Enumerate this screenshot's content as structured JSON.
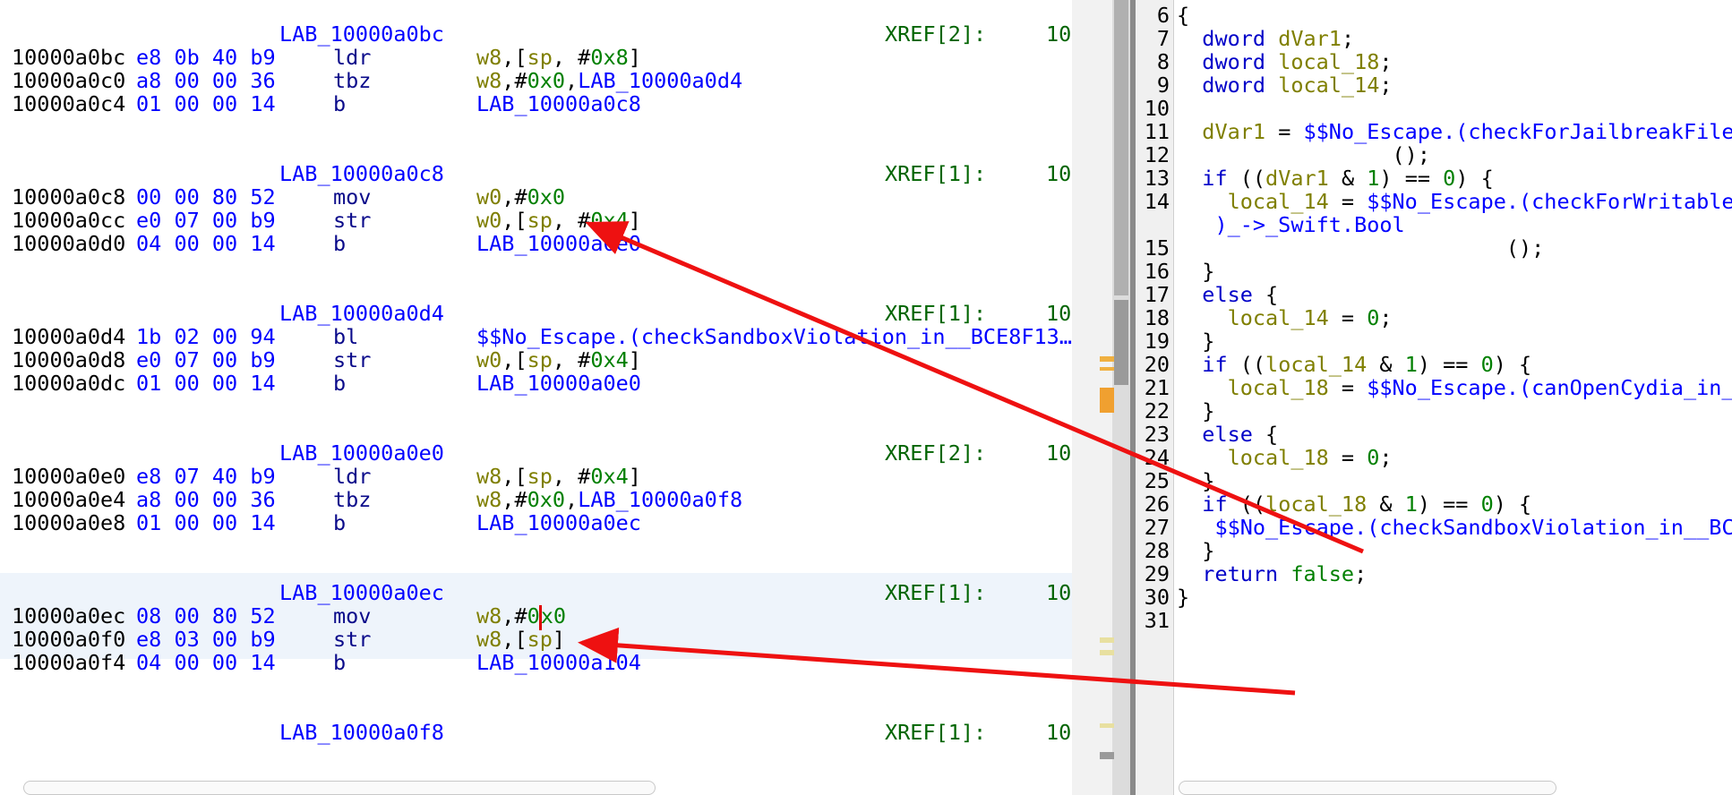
{
  "listing": {
    "blocks": [
      {
        "label": "LAB_10000a0bc",
        "xref": "XREF[2]:",
        "xref_val": "10",
        "rows": [
          {
            "addr": "10000a0bc",
            "bytes": "e8 0b 40 b9",
            "mnem": "ldr",
            "ops": [
              [
                "reg",
                "w8"
              ],
              [
                "blk",
                ",["
              ],
              [
                "reg",
                "sp"
              ],
              [
                "blk",
                ", #"
              ],
              [
                "num",
                "0x8"
              ],
              [
                "blk",
                "]"
              ]
            ]
          },
          {
            "addr": "10000a0c0",
            "bytes": "a8 00 00 36",
            "mnem": "tbz",
            "ops": [
              [
                "reg",
                "w8"
              ],
              [
                "blk",
                ",#"
              ],
              [
                "num",
                "0x0"
              ],
              [
                "blk",
                ","
              ],
              [
                "lnk",
                "LAB_10000a0d4"
              ]
            ]
          },
          {
            "addr": "10000a0c4",
            "bytes": "01 00 00 14",
            "mnem": "b",
            "ops": [
              [
                "lnk",
                "LAB_10000a0c8"
              ]
            ]
          }
        ]
      },
      {
        "label": "LAB_10000a0c8",
        "xref": "XREF[1]:",
        "xref_val": "10",
        "rows": [
          {
            "addr": "10000a0c8",
            "bytes": "00 00 80 52",
            "mnem": "mov",
            "ops": [
              [
                "reg",
                "w0"
              ],
              [
                "blk",
                ",#"
              ],
              [
                "num",
                "0x0"
              ]
            ]
          },
          {
            "addr": "10000a0cc",
            "bytes": "e0 07 00 b9",
            "mnem": "str",
            "ops": [
              [
                "reg",
                "w0"
              ],
              [
                "blk",
                ",["
              ],
              [
                "reg",
                "sp"
              ],
              [
                "blk",
                ", #"
              ],
              [
                "num",
                "0x4"
              ],
              [
                "blk",
                "]"
              ]
            ]
          },
          {
            "addr": "10000a0d0",
            "bytes": "04 00 00 14",
            "mnem": "b",
            "ops": [
              [
                "lnk",
                "LAB_10000a0e0"
              ]
            ]
          }
        ]
      },
      {
        "label": "LAB_10000a0d4",
        "xref": "XREF[1]:",
        "xref_val": "10",
        "rows": [
          {
            "addr": "10000a0d4",
            "bytes": "1b 02 00 94",
            "mnem": "bl",
            "ops": [
              [
                "lnk",
                "$$No_Escape.(checkSandboxViolation_in__BCE8F13…"
              ]
            ]
          },
          {
            "addr": "10000a0d8",
            "bytes": "e0 07 00 b9",
            "mnem": "str",
            "ops": [
              [
                "reg",
                "w0"
              ],
              [
                "blk",
                ",["
              ],
              [
                "reg",
                "sp"
              ],
              [
                "blk",
                ", #"
              ],
              [
                "num",
                "0x4"
              ],
              [
                "blk",
                "]"
              ]
            ]
          },
          {
            "addr": "10000a0dc",
            "bytes": "01 00 00 14",
            "mnem": "b",
            "ops": [
              [
                "lnk",
                "LAB_10000a0e0"
              ]
            ]
          }
        ]
      },
      {
        "label": "LAB_10000a0e0",
        "xref": "XREF[2]:",
        "xref_val": "10",
        "rows": [
          {
            "addr": "10000a0e0",
            "bytes": "e8 07 40 b9",
            "mnem": "ldr",
            "ops": [
              [
                "reg",
                "w8"
              ],
              [
                "blk",
                ",["
              ],
              [
                "reg",
                "sp"
              ],
              [
                "blk",
                ", #"
              ],
              [
                "num",
                "0x4"
              ],
              [
                "blk",
                "]"
              ]
            ]
          },
          {
            "addr": "10000a0e4",
            "bytes": "a8 00 00 36",
            "mnem": "tbz",
            "ops": [
              [
                "reg",
                "w8"
              ],
              [
                "blk",
                ",#"
              ],
              [
                "num",
                "0x0"
              ],
              [
                "blk",
                ","
              ],
              [
                "lnk",
                "LAB_10000a0f8"
              ]
            ]
          },
          {
            "addr": "10000a0e8",
            "bytes": "01 00 00 14",
            "mnem": "b",
            "ops": [
              [
                "lnk",
                "LAB_10000a0ec"
              ]
            ]
          }
        ]
      },
      {
        "label": "LAB_10000a0ec",
        "xref": "XREF[1]:",
        "xref_val": "10",
        "rows": [
          {
            "addr": "10000a0ec",
            "bytes": "08 00 80 52",
            "mnem": "mov",
            "ops": [
              [
                "reg",
                "w8"
              ],
              [
                "blk",
                ",#"
              ],
              [
                "num",
                "0"
              ],
              [
                "cursor",
                ""
              ],
              [
                "num",
                "x0"
              ]
            ]
          },
          {
            "addr": "10000a0f0",
            "bytes": "e8 03 00 b9",
            "mnem": "str",
            "ops": [
              [
                "reg",
                "w8"
              ],
              [
                "blk",
                ",["
              ],
              [
                "reg",
                "sp"
              ],
              [
                "blk",
                "]"
              ]
            ]
          },
          {
            "addr": "10000a0f4",
            "bytes": "04 00 00 14",
            "mnem": "b",
            "ops": [
              [
                "lnk",
                "LAB_10000a104"
              ]
            ]
          }
        ]
      },
      {
        "label": "LAB_10000a0f8",
        "xref": "XREF[1]:",
        "xref_val": "10",
        "rows": []
      }
    ]
  },
  "decompiler": {
    "lines": [
      {
        "n": "6",
        "t": [
          [
            "pl",
            "{"
          ]
        ]
      },
      {
        "n": "7",
        "t": [
          [
            "ty",
            "  dword "
          ],
          [
            "var",
            "dVar1"
          ],
          [
            "pl",
            ";"
          ]
        ]
      },
      {
        "n": "8",
        "t": [
          [
            "ty",
            "  dword "
          ],
          [
            "var",
            "local_18"
          ],
          [
            "pl",
            ";"
          ]
        ]
      },
      {
        "n": "9",
        "t": [
          [
            "ty",
            "  dword "
          ],
          [
            "var",
            "local_14"
          ],
          [
            "pl",
            ";"
          ]
        ]
      },
      {
        "n": "10",
        "t": []
      },
      {
        "n": "11",
        "t": [
          [
            "var",
            "  dVar1"
          ],
          [
            "pl",
            " = "
          ],
          [
            "fn",
            "$$No_Escape.(checkForJailbreakFiles"
          ]
        ]
      },
      {
        "n": "12",
        "t": [
          [
            "pl",
            "                 ();"
          ]
        ]
      },
      {
        "n": "13",
        "t": [
          [
            "kw",
            "  if"
          ],
          [
            "pl",
            " (("
          ],
          [
            "var",
            "dVar1"
          ],
          [
            "pl",
            " & "
          ],
          [
            "nm",
            "1"
          ],
          [
            "pl",
            ") == "
          ],
          [
            "nm",
            "0"
          ],
          [
            "pl",
            ") {"
          ]
        ]
      },
      {
        "n": "14",
        "t": [
          [
            "var",
            "    local_14"
          ],
          [
            "pl",
            " = "
          ],
          [
            "fn",
            "$$No_Escape.(checkForWritableS"
          ]
        ]
      },
      {
        "n": "",
        "t": [
          [
            "fn",
            "   )_->_Swift.Bool"
          ]
        ]
      },
      {
        "n": "15",
        "t": [
          [
            "pl",
            "                          ();"
          ]
        ]
      },
      {
        "n": "16",
        "t": [
          [
            "pl",
            "  }"
          ]
        ]
      },
      {
        "n": "17",
        "t": [
          [
            "kw",
            "  else"
          ],
          [
            "pl",
            " {"
          ]
        ]
      },
      {
        "n": "18",
        "t": [
          [
            "var",
            "    local_14"
          ],
          [
            "pl",
            " = "
          ],
          [
            "nm",
            "0"
          ],
          [
            "pl",
            ";"
          ]
        ]
      },
      {
        "n": "19",
        "t": [
          [
            "pl",
            "  }"
          ]
        ]
      },
      {
        "n": "20",
        "t": [
          [
            "kw",
            "  if"
          ],
          [
            "pl",
            " (("
          ],
          [
            "var",
            "local_14"
          ],
          [
            "pl",
            " & "
          ],
          [
            "nm",
            "1"
          ],
          [
            "pl",
            ") == "
          ],
          [
            "nm",
            "0"
          ],
          [
            "pl",
            ") {"
          ]
        ]
      },
      {
        "n": "21",
        "t": [
          [
            "var",
            "    local_18"
          ],
          [
            "pl",
            " = "
          ],
          [
            "fn",
            "$$No_Escape.(canOpenCydia_in__"
          ]
        ]
      },
      {
        "n": "22",
        "t": [
          [
            "pl",
            "  }"
          ]
        ]
      },
      {
        "n": "23",
        "t": [
          [
            "kw",
            "  else"
          ],
          [
            "pl",
            " {"
          ]
        ]
      },
      {
        "n": "24",
        "t": [
          [
            "var",
            "    local_18"
          ],
          [
            "pl",
            " = "
          ],
          [
            "nm",
            "0"
          ],
          [
            "pl",
            ";"
          ]
        ]
      },
      {
        "n": "25",
        "t": [
          [
            "pl",
            "  }"
          ]
        ]
      },
      {
        "n": "26",
        "t": [
          [
            "kw",
            "  if"
          ],
          [
            "pl",
            " (("
          ],
          [
            "var",
            "local_18"
          ],
          [
            "pl",
            " & "
          ],
          [
            "nm",
            "1"
          ],
          [
            "pl",
            ") == "
          ],
          [
            "nm",
            "0"
          ],
          [
            "pl",
            ") {"
          ]
        ]
      },
      {
        "n": "27",
        "t": [
          [
            "fn",
            "   $$No_Escape.(checkSandboxViolation_in__BC"
          ]
        ]
      },
      {
        "n": "28",
        "t": [
          [
            "pl",
            "  }"
          ]
        ]
      },
      {
        "n": "29",
        "t": [
          [
            "kw",
            "  return "
          ],
          [
            "nm",
            "false"
          ],
          [
            "pl",
            ";"
          ]
        ]
      },
      {
        "n": "30",
        "t": [
          [
            "pl",
            "}"
          ]
        ]
      },
      {
        "n": "31",
        "t": []
      }
    ]
  },
  "colors": {
    "arrow": "#ee1111",
    "label_blue": "#0000ff",
    "register": "#7f7f00",
    "number_green": "#008000",
    "highlight": "#eef4fb"
  }
}
